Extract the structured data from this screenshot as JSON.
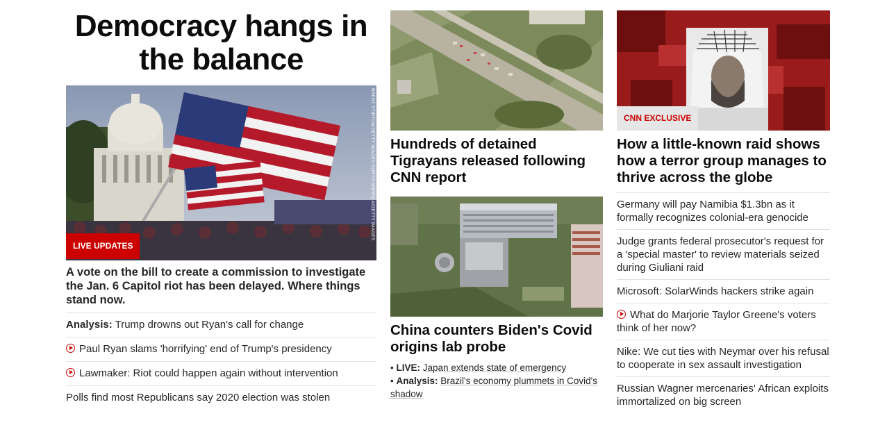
{
  "left": {
    "headline": "Democracy hangs in the balance",
    "image_credit": "BRENT STIRTON/GETTY IMAGES NORTH AMERICA/GETTY IMAGES",
    "badge": "LIVE UPDATES",
    "lead": "A vote on the bill to create a commission to investigate the Jan. 6 Capitol riot has been delayed. Where things stand now.",
    "items": [
      {
        "label": "Analysis:",
        "text": "Trump drowns out Ryan's call for change",
        "video": false
      },
      {
        "label": "",
        "text": "Paul Ryan slams 'horrifying' end of Trump's presidency",
        "video": true
      },
      {
        "label": "",
        "text": "Lawmaker: Riot could happen again without intervention",
        "video": true
      },
      {
        "label": "",
        "text": "Polls find most Republicans say 2020 election was stolen",
        "video": false
      }
    ]
  },
  "middle": {
    "story1": "Hundreds of detained Tigrayans released following CNN report",
    "story2": "China counters Biden's Covid origins lab probe",
    "bullets": [
      {
        "label": "LIVE:",
        "text": "Japan extends state of emergency"
      },
      {
        "label": "Analysis:",
        "text": "Brazil's economy plummets in Covid's shadow"
      }
    ]
  },
  "right": {
    "badge": "CNN EXCLUSIVE",
    "headline": "How a little-known raid shows how a terror group manages to thrive across the globe",
    "items": [
      {
        "text": "Germany will pay Namibia $1.3bn as it formally recognizes colonial-era genocide",
        "video": false
      },
      {
        "text": "Judge grants federal prosecutor's request for a 'special master' to review materials seized during Giuliani raid",
        "video": false
      },
      {
        "text": "Microsoft: SolarWinds hackers strike again",
        "video": false
      },
      {
        "text": "What do Marjorie Taylor Greene's voters think of her now?",
        "video": true
      },
      {
        "text": "Nike: We cut ties with Neymar over his refusal to cooperate in sex assault investigation",
        "video": false
      },
      {
        "text": "Russian Wagner mercenaries' African exploits immortalized on big screen",
        "video": false
      }
    ]
  },
  "colors": {
    "accent": "#cc0000",
    "text": "#262626"
  }
}
